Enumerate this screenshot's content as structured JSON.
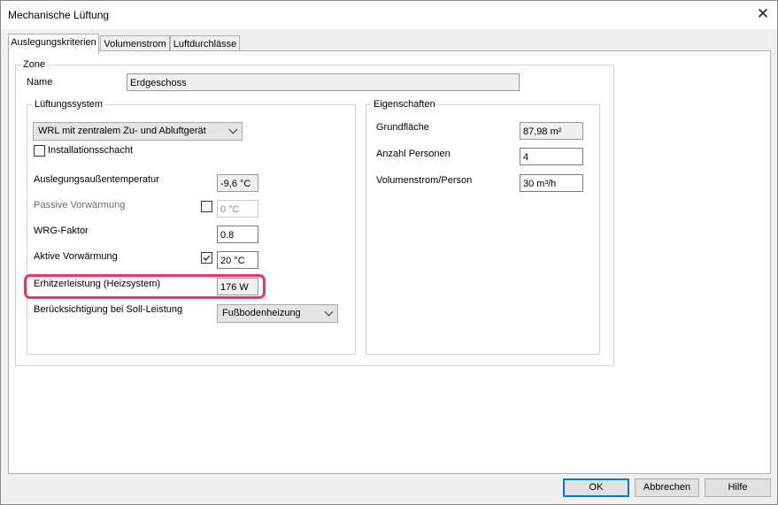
{
  "window": {
    "title": "Mechanische Lüftung",
    "close_glyph": "✕"
  },
  "tabs": [
    {
      "label": "Auslegungskriterien",
      "active": true
    },
    {
      "label": "Volumenstrom",
      "active": false
    },
    {
      "label": "Luftdurchlässe",
      "active": false
    }
  ],
  "zone": {
    "legend": "Zone",
    "name_label": "Name",
    "name_value": "Erdgeschoss"
  },
  "lueftungssystem": {
    "legend": "Lüftungssystem",
    "system_value": "WRL mit zentralem Zu- und Abluftgerät",
    "installationsschacht_label": "Installationsschacht",
    "installationsschacht_checked": false,
    "auslegung_label": "Auslegungsaußentemperatur",
    "auslegung_value": "-9,6 °C",
    "passive_label": "Passive Vorwärmung",
    "passive_checked": false,
    "passive_value": "0 °C",
    "wrg_label": "WRG-Faktor",
    "wrg_value": "0.8",
    "aktive_label": "Aktive Vorwärmung",
    "aktive_checked": true,
    "aktive_value": "20 °C",
    "erhitzer_label": "Erhitzerleistung (Heizsystem)",
    "erhitzer_value": "176 W",
    "soll_label": "Berücksichtigung bei Soll-Leistung",
    "soll_value": "Fußbodenheizung"
  },
  "eigenschaften": {
    "legend": "Eigenschaften",
    "grundflaeche_label": "Grundfläche",
    "grundflaeche_value": "87,98 m²",
    "personen_label": "Anzahl Personen",
    "personen_value": "4",
    "volumenstrom_label": "Volumenstrom/Person",
    "volumenstrom_value": "30 m³/h"
  },
  "buttons": {
    "ok": "OK",
    "cancel": "Abbrechen",
    "help": "Hilfe"
  },
  "colors": {
    "highlight": "#e8366e",
    "default_button_border": "#0078d7"
  }
}
